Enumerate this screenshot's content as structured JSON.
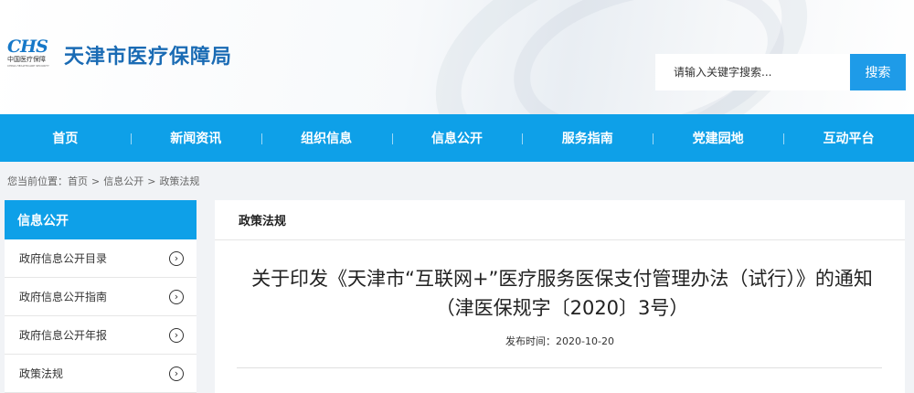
{
  "header": {
    "logo_mark": "CHS",
    "logo_sub": "中国医疗保障",
    "logo_sub_en": "CHINA HEALTHCARE SECURITY",
    "site_title": "天津市医疗保障局",
    "search_placeholder": "请输入关键字搜索...",
    "search_button": "搜索"
  },
  "nav": {
    "items": [
      "首页",
      "新闻资讯",
      "组织信息",
      "信息公开",
      "服务指南",
      "党建园地",
      "互动平台"
    ]
  },
  "breadcrumb": {
    "prefix": "您当前位置：",
    "items": [
      "首页",
      "信息公开",
      "政策法规"
    ],
    "separator": ">"
  },
  "sidebar": {
    "title": "信息公开",
    "items": [
      {
        "label": "政府信息公开目录",
        "icon": "chevron-circle-right-icon"
      },
      {
        "label": "政府信息公开指南",
        "icon": "chevron-circle-right-icon"
      },
      {
        "label": "政府信息公开年报",
        "icon": "chevron-circle-right-icon"
      },
      {
        "label": "政策法规",
        "icon": "chevron-circle-right-icon"
      }
    ]
  },
  "main": {
    "section_title": "政策法规",
    "article_title": "关于印发《天津市“互联网+”医疗服务医保支付管理办法（试行）》的通知（津医保规字〔2020〕3号）",
    "publish_date": "发布时间：2020-10-20"
  },
  "colors": {
    "primary": "#0ea0e8",
    "title_blue": "#1a6bb4"
  }
}
